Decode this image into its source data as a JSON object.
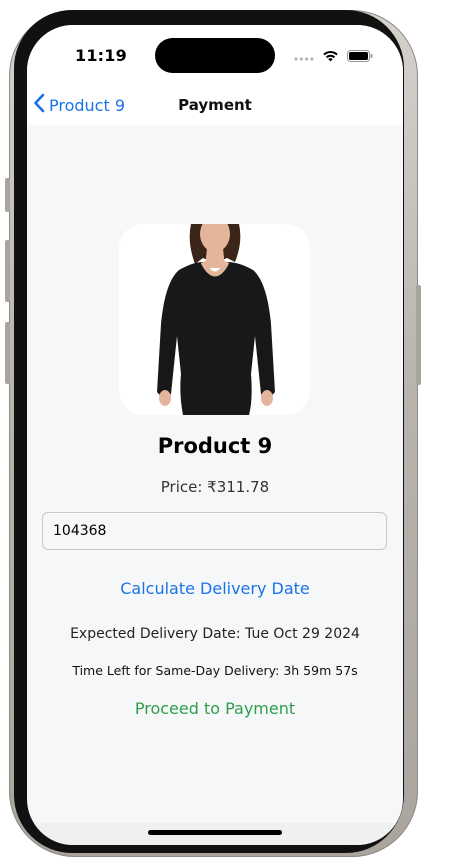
{
  "status_bar": {
    "time": "11:19",
    "icons": [
      "signal-dots-icon",
      "wifi-icon",
      "battery-icon"
    ]
  },
  "nav": {
    "back_label": "Product 9",
    "title": "Payment"
  },
  "product": {
    "image_icon": "product-photo-black-top",
    "name": "Product 9",
    "price": "Price: ₹311.78"
  },
  "pincode": {
    "value": "104368"
  },
  "actions": {
    "calculate_label": "Calculate Delivery Date",
    "proceed_label": "Proceed to Payment"
  },
  "delivery": {
    "expected": "Expected Delivery Date: Tue Oct 29 2024",
    "time_left": "Time Left for Same-Day Delivery: 3h 59m 57s"
  },
  "colors": {
    "link_blue": "#1a73e8",
    "proceed_green": "#2e9e4a",
    "screen_bg": "#f6f7f8"
  }
}
